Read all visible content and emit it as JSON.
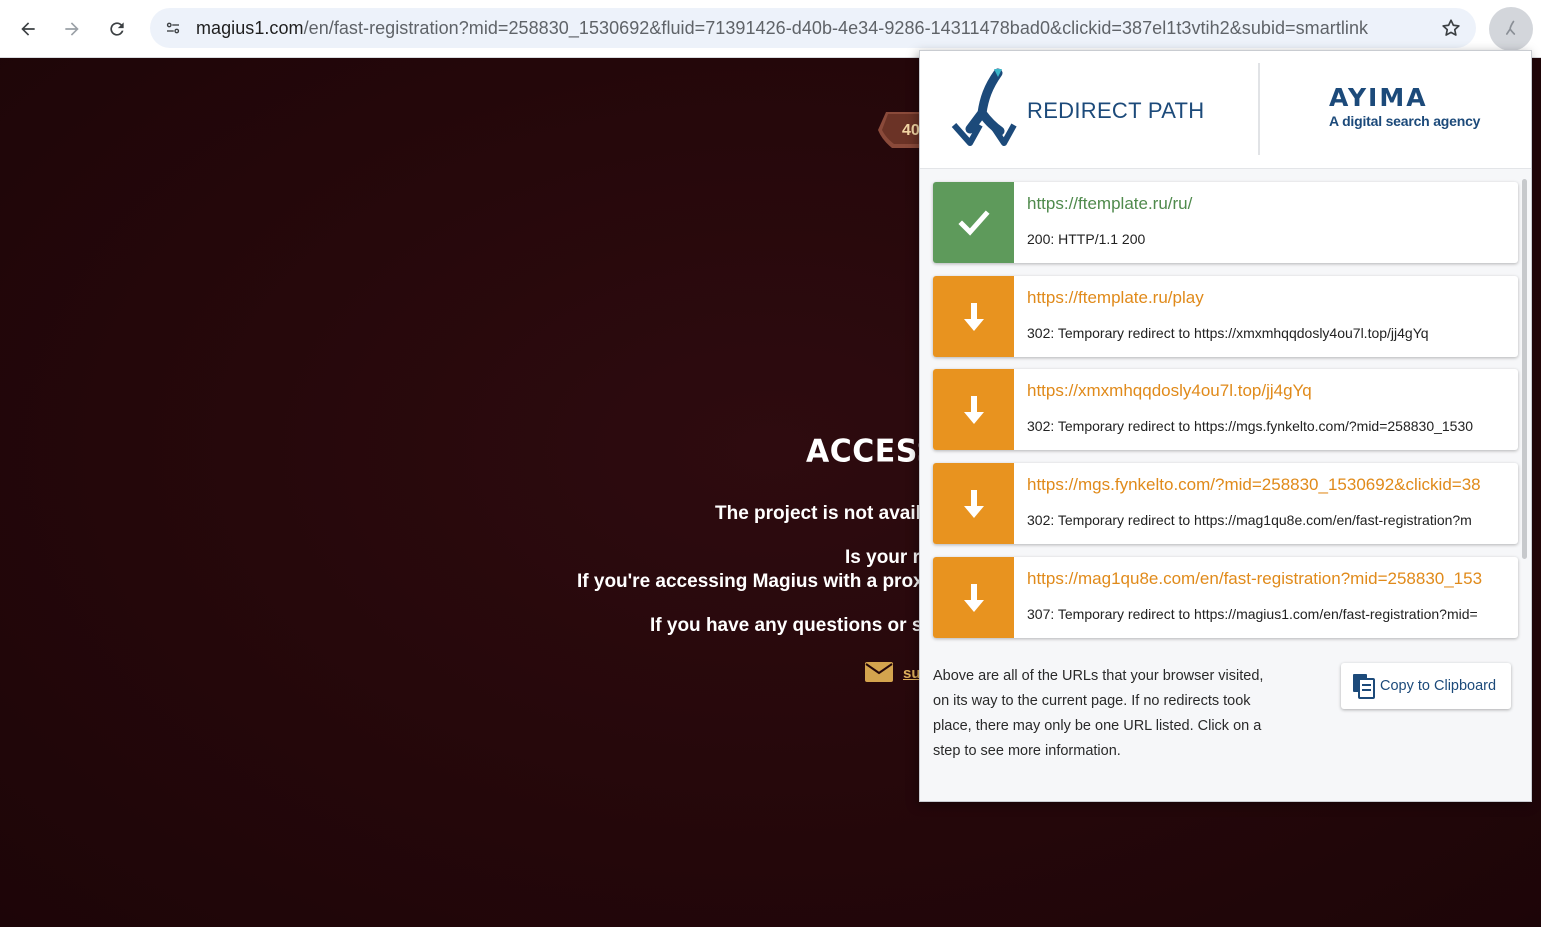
{
  "browser": {
    "url_host": "magius1.com",
    "url_rest": "/en/fast-registration?mid=258830_1530692&fluid=71391426-d40b-4e34-9286-14311478bad0&clickid=387el1t3vtih2&subid=smartlink",
    "icons": [
      "back-arrow-icon",
      "forward-arrow-icon",
      "reload-icon",
      "site-info-icon",
      "star-icon",
      "redirect-path-extension-icon"
    ]
  },
  "page": {
    "ribbon_text": "40",
    "title": "ACCESS",
    "line1": "The project is not availabl",
    "line2": "Is your re",
    "line3": "If you're accessing Magius with a proxy ser",
    "line4": "If you have any questions or sugg",
    "mail_link": "su"
  },
  "popup": {
    "brand_name": "REDIRECT PATH",
    "agency_name": "AYIMA",
    "agency_tagline": "A digital search agency",
    "steps": [
      {
        "kind": "ok",
        "icon": "checkmark-icon",
        "url": "https://ftemplate.ru/ru/",
        "status": "200: HTTP/1.1 200"
      },
      {
        "kind": "redir",
        "icon": "down-arrow-icon",
        "url": "https://ftemplate.ru/play",
        "status": "302: Temporary redirect to https://xmxmhqqdosly4ou7l.top/jj4gYq"
      },
      {
        "kind": "redir",
        "icon": "down-arrow-icon",
        "url": "https://xmxmhqqdosly4ou7l.top/jj4gYq",
        "status": "302: Temporary redirect to https://mgs.fynkelto.com/?mid=258830_1530"
      },
      {
        "kind": "redir",
        "icon": "down-arrow-icon",
        "url": "https://mgs.fynkelto.com/?mid=258830_1530692&clickid=38",
        "status": "302: Temporary redirect to https://mag1qu8e.com/en/fast-registration?m"
      },
      {
        "kind": "redir",
        "icon": "down-arrow-icon",
        "url": "https://mag1qu8e.com/en/fast-registration?mid=258830_153",
        "status": "307: Temporary redirect to https://magius1.com/en/fast-registration?mid="
      }
    ],
    "footer_text": "Above are all of the URLs that your browser visited, on its way to the current page. If no redirects took place, there may only be one URL listed. Click on a step to see more information.",
    "copy_button": "Copy to Clipboard"
  },
  "colors": {
    "page_bg": "#24070a",
    "ok_green": "#5e9a5b",
    "redirect_orange": "#e8931f",
    "brand_blue": "#1c4a7a"
  }
}
